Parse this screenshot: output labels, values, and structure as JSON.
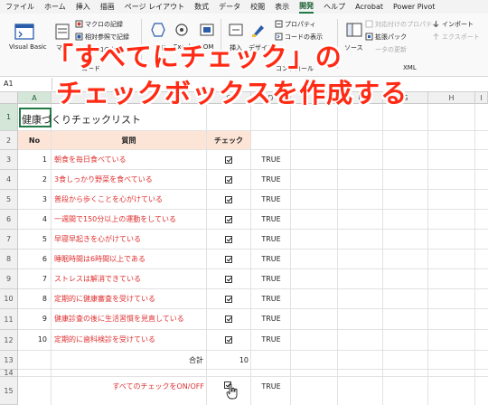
{
  "menu_tabs": [
    "ファイル",
    "ホーム",
    "挿入",
    "描画",
    "ページ レイアウト",
    "数式",
    "データ",
    "校閲",
    "表示",
    "開発",
    "ヘルプ",
    "Acrobat",
    "Power Pivot"
  ],
  "active_tab": "開発",
  "ribbon": {
    "visual_basic": "Visual Basic",
    "macro": "マ",
    "record_macro": "マクロの記録",
    "relative_ref": "相対参照で記録",
    "macro_security": "マクロのセ",
    "addins": "アド",
    "excel": "Excel",
    "com": "COM",
    "insert": "挿入",
    "design": "デザイン",
    "properties": "プロパティ",
    "view_code": "コードの表示",
    "run_dialog": "行",
    "source": "ソース",
    "map_props": "対応付けのプロパティ",
    "expansion_pack": "拡張パック",
    "refresh_data": "ータの更新",
    "import": "インポート",
    "export": "エクスポート",
    "xml": "XML",
    "code_group": "コード",
    "control_group": "コントロール"
  },
  "formula_bar": {
    "name_box": "A1"
  },
  "columns": [
    "A",
    "B",
    "C",
    "D",
    "E",
    "F",
    "G",
    "H",
    "I"
  ],
  "selected_col": "A",
  "row_numbers": [
    "1",
    "2",
    "3",
    "4",
    "5",
    "6",
    "7",
    "8",
    "9",
    "10",
    "11",
    "12",
    "13",
    "14",
    "15"
  ],
  "sheet": {
    "title": "健康づくりチェックリスト",
    "headers": {
      "no": "No",
      "question": "質問",
      "check": "チェック"
    },
    "items": [
      {
        "no": "1",
        "text": "朝食を毎日食べている",
        "value": "TRUE"
      },
      {
        "no": "2",
        "text": "3食しっかり野菜を食べている",
        "value": "TRUE"
      },
      {
        "no": "3",
        "text": "普段から歩くことを心がけている",
        "value": "TRUE"
      },
      {
        "no": "4",
        "text": "一週間で150分以上の運動をしている",
        "value": "TRUE"
      },
      {
        "no": "5",
        "text": "早寝早起きを心がけている",
        "value": "TRUE"
      },
      {
        "no": "6",
        "text": "睡眠時間は6時間以上である",
        "value": "TRUE"
      },
      {
        "no": "7",
        "text": "ストレスは解消できている",
        "value": "TRUE"
      },
      {
        "no": "8",
        "text": "定期的に健康審査を受けている",
        "value": "TRUE"
      },
      {
        "no": "9",
        "text": "健康診査の後に生活習慣を見直している",
        "value": "TRUE"
      },
      {
        "no": "10",
        "text": "定期的に歯科検診を受けている",
        "value": "TRUE"
      }
    ],
    "total_label": "合計",
    "total_value": "10",
    "toggle_label": "すべてのチェックをON/OFF",
    "toggle_value": "TRUE"
  },
  "overlay": {
    "line1": "「すべてにチェック」の",
    "line2": "チェックボックスを作成する"
  },
  "colors": {
    "accent": "#1f7a45",
    "header_fill": "#fce4d6",
    "question_text": "#e03030",
    "overlay_text": "#ff2a14"
  }
}
